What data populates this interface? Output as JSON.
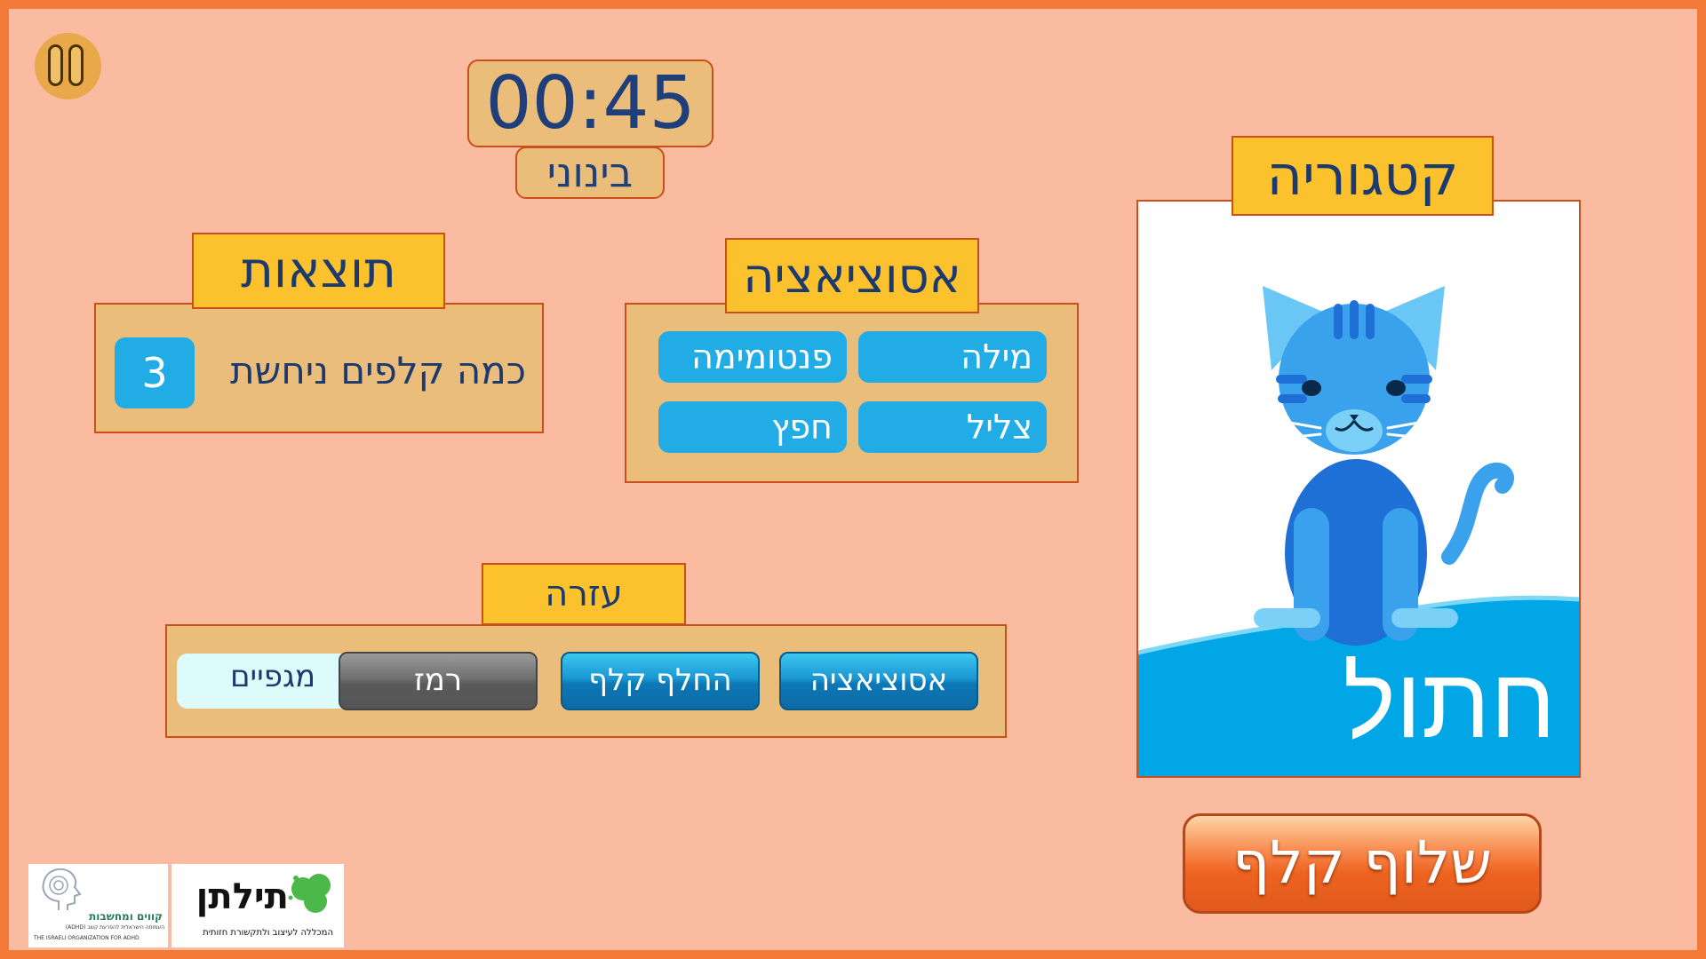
{
  "timer": "00:45",
  "difficulty": "בינוני",
  "results": {
    "title": "תוצאות",
    "label": "כמה קלפים ניחשת",
    "count": "3"
  },
  "association": {
    "title": "אסוציאציה",
    "options": [
      "מילה",
      "פנטומימה",
      "צליל",
      "חפץ"
    ]
  },
  "help": {
    "title": "עזרה",
    "associate_button": "אסוציאציה",
    "swap_button": "החלף קלף",
    "hint_button": "רמז",
    "shields_label": "מגפיים"
  },
  "category": {
    "title": "קטגוריה",
    "card_word": "חתול",
    "card_image": "blue-cat"
  },
  "draw_button": "שלוף קלף",
  "logos": {
    "left_name": "קווים ומחשבות",
    "left_subtitle": "העמותה הישראלית להפרעת קשב (ADHD)",
    "left_english": "THE ISRAELI ORGANIZATION FOR ADHD",
    "right_name": "תילתן",
    "right_subtitle": "המכללה לעיצוב ולתקשורת חזותית"
  },
  "colors": {
    "background": "#fbbba0",
    "border": "#f27a36",
    "panel": "#ebbd7a",
    "tag": "#fbc22e",
    "tile": "#22ace6",
    "text": "#1c3a6e"
  }
}
